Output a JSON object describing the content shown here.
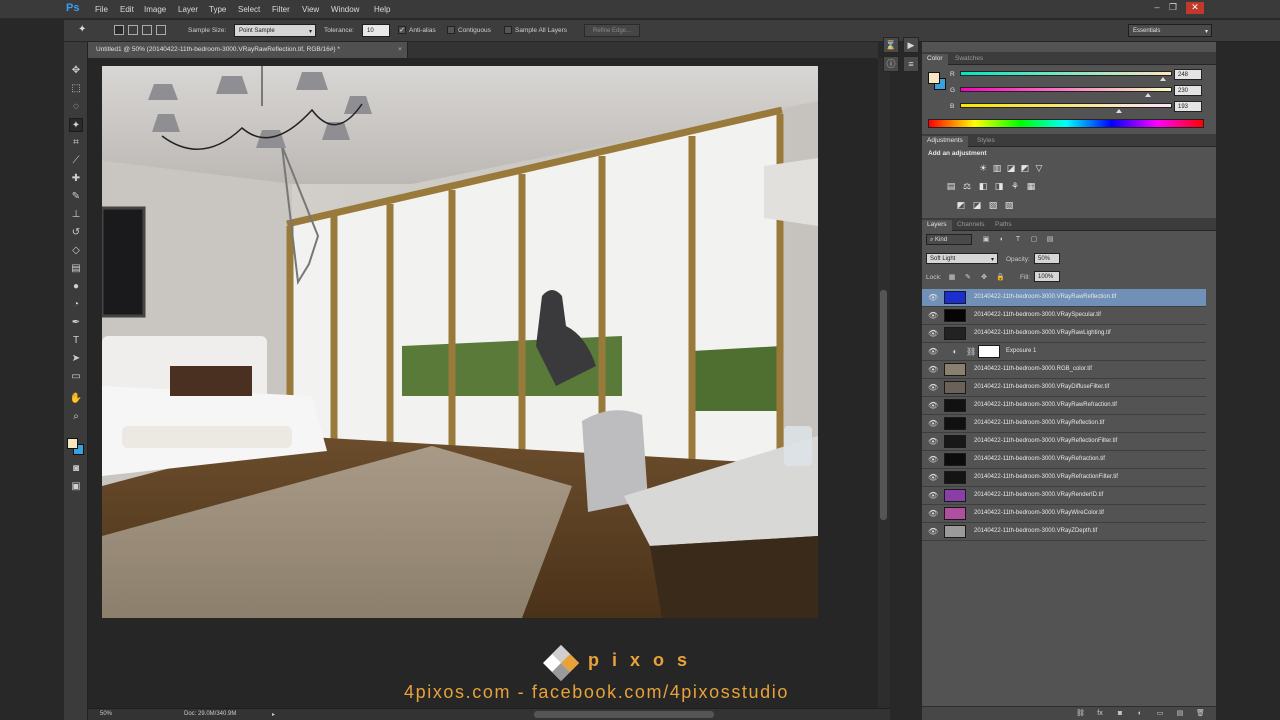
{
  "app": {
    "logo": "Ps"
  },
  "menu": [
    "File",
    "Edit",
    "Image",
    "Layer",
    "Type",
    "Select",
    "Filter",
    "View",
    "Window",
    "Help"
  ],
  "window_controls": {
    "minimize": "–",
    "restore": "❐",
    "close": "✕"
  },
  "options": {
    "sample_size_label": "Sample Size:",
    "sample_size_value": "Point Sample",
    "tolerance_label": "Tolerance:",
    "tolerance_value": "10",
    "anti_alias_label": "Anti-alias",
    "contiguous_label": "Contiguous",
    "sample_all_label": "Sample All Layers",
    "refine_edge": "Refine Edge...",
    "workspace": "Essentials"
  },
  "document": {
    "tab_title": "Untitled1 @ 50% (20140422-11th-bedroom-3000.VRayRawReflection.tif, RGB/16#) *",
    "close": "×"
  },
  "status": {
    "zoom": "50%",
    "doc_info": "Doc: 29.0M/340.9M"
  },
  "watermark": {
    "brand": "pixos",
    "url": "4pixos.com - facebook.com/4pixosstudio",
    "brand_color": "#e8a23a"
  },
  "color_panel": {
    "tabs": [
      "Color",
      "Swatches"
    ],
    "foreground": "#f8e6c1",
    "background": "#3aa0e0",
    "channels": [
      {
        "label": "R",
        "value": "248",
        "fraction": 0.97
      },
      {
        "label": "G",
        "value": "230",
        "fraction": 0.9
      },
      {
        "label": "B",
        "value": "193",
        "fraction": 0.76
      }
    ]
  },
  "adjustments_panel": {
    "tabs": [
      "Adjustments",
      "Styles"
    ],
    "heading": "Add an adjustment",
    "row1": [
      "☀",
      "▥",
      "◪",
      "◩",
      "▽"
    ],
    "row2": [
      "▤",
      "⚖",
      "◧",
      "◨",
      "⚘",
      "▦"
    ],
    "row3": [
      "◩",
      "◪",
      "▨",
      "▧"
    ]
  },
  "layers_panel": {
    "tabs": [
      "Layers",
      "Channels",
      "Paths"
    ],
    "filter_kind": "Kind",
    "blend_mode": "Soft Light",
    "opacity_label": "Opacity:",
    "opacity_value": "50%",
    "lock_label": "Lock:",
    "fill_label": "Fill:",
    "fill_value": "100%",
    "eye": "👁",
    "layers": [
      {
        "name": "20140422-11th-bedroom-3000.VRayRawReflection.tif",
        "selected": true,
        "thumb": "#1b2fd0"
      },
      {
        "name": "20140422-11th-bedroom-3000.VRaySpecular.tif",
        "selected": false,
        "thumb": "#050505"
      },
      {
        "name": "20140422-11th-bedroom-3000.VRayRawLighting.tif",
        "selected": false,
        "thumb": "#222222"
      },
      {
        "name": "Exposure 1",
        "selected": false,
        "thumb": "#ffffff",
        "adjustment": true
      },
      {
        "name": "20140422-11th-bedroom-3000.RGB_color.tif",
        "selected": false,
        "thumb": "#8a8070"
      },
      {
        "name": "20140422-11th-bedroom-3000.VRayDiffuseFilter.tif",
        "selected": false,
        "thumb": "#6a6258"
      },
      {
        "name": "20140422-11th-bedroom-3000.VRayRawRefraction.tif",
        "selected": false,
        "thumb": "#111111"
      },
      {
        "name": "20140422-11th-bedroom-3000.VRayReflection.tif",
        "selected": false,
        "thumb": "#101010"
      },
      {
        "name": "20140422-11th-bedroom-3000.VRayReflectionFilter.tif",
        "selected": false,
        "thumb": "#181818"
      },
      {
        "name": "20140422-11th-bedroom-3000.VRayRefraction.tif",
        "selected": false,
        "thumb": "#0c0c0c"
      },
      {
        "name": "20140422-11th-bedroom-3000.VRayRefractionFilter.tif",
        "selected": false,
        "thumb": "#141414"
      },
      {
        "name": "20140422-11th-bedroom-3000.VRayRenderID.tif",
        "selected": false,
        "thumb": "#8a3fa8"
      },
      {
        "name": "20140422-11th-bedroom-3000.VRayWireColor.tif",
        "selected": false,
        "thumb": "#b04fa0"
      },
      {
        "name": "20140422-11th-bedroom-3000.VRayZDepth.tif",
        "selected": false,
        "thumb": "#9a9a9a"
      }
    ]
  }
}
